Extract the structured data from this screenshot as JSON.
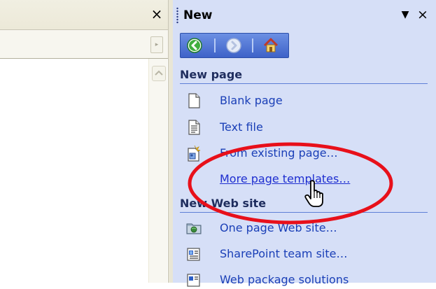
{
  "left_pane": {
    "close_glyph": "×",
    "scroll_right_glyph": "▸"
  },
  "task_pane": {
    "title": "New",
    "dropdown_glyph": "▼",
    "close_glyph": "×",
    "nav": {
      "back_icon": "back-arrow-icon",
      "forward_icon": "forward-arrow-icon",
      "home_icon": "home-icon"
    },
    "sections": {
      "new_page": {
        "heading": "New page",
        "items": [
          {
            "label": "Blank page",
            "icon": "blank-page-icon"
          },
          {
            "label": "Text file",
            "icon": "text-file-icon"
          },
          {
            "label": "From existing page…",
            "icon": "existing-page-icon"
          },
          {
            "label": "More page templates…",
            "icon": ""
          }
        ]
      },
      "new_web_site": {
        "heading": "New Web site",
        "items": [
          {
            "label": "One page Web site…",
            "icon": "web-site-folder-icon"
          },
          {
            "label": "SharePoint team site…",
            "icon": "sharepoint-icon"
          },
          {
            "label": "Web package solutions",
            "icon": "web-package-icon"
          }
        ]
      }
    }
  },
  "annotation": {
    "highlight_color": "#e8101a",
    "cursor": "hand-pointer-icon"
  }
}
